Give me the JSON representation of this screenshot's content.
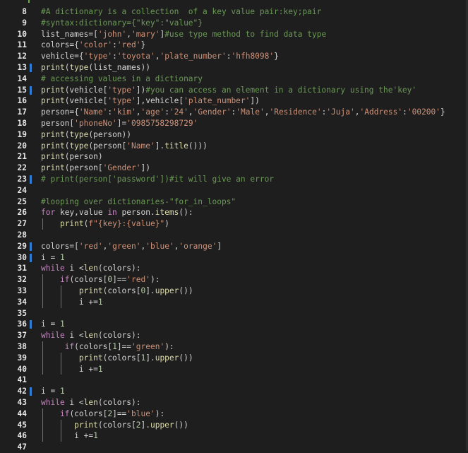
{
  "editor": {
    "lines": [
      {
        "n": "8",
        "bar": false,
        "indent": 0,
        "tokens": [
          [
            "#A dictionary is a collection  of a key value pair:key;pair",
            "t-comment"
          ]
        ]
      },
      {
        "n": "9",
        "bar": false,
        "indent": 0,
        "tokens": [
          [
            "#syntax:dictionary={\"key\":\"value\"}",
            "t-comment"
          ]
        ]
      },
      {
        "n": "10",
        "bar": false,
        "indent": 0,
        "tokens": [
          [
            "list_names",
            "t-plain"
          ],
          [
            "=[",
            "t-plain"
          ],
          [
            "'john'",
            "t-string"
          ],
          [
            ",",
            "t-plain"
          ],
          [
            "'mary'",
            "t-string"
          ],
          [
            "]",
            "t-plain"
          ],
          [
            "#use type method to find data type",
            "t-comment"
          ]
        ]
      },
      {
        "n": "11",
        "bar": false,
        "indent": 0,
        "tokens": [
          [
            "colors",
            "t-plain"
          ],
          [
            "={",
            "t-plain"
          ],
          [
            "'color'",
            "t-string"
          ],
          [
            ":",
            "t-plain"
          ],
          [
            "'red'",
            "t-string"
          ],
          [
            "}",
            "t-plain"
          ]
        ]
      },
      {
        "n": "12",
        "bar": false,
        "indent": 0,
        "tokens": [
          [
            "vehicle",
            "t-plain"
          ],
          [
            "={",
            "t-plain"
          ],
          [
            "'type'",
            "t-string"
          ],
          [
            ":",
            "t-plain"
          ],
          [
            "'toyota'",
            "t-string"
          ],
          [
            ",",
            "t-plain"
          ],
          [
            "'plate_number'",
            "t-string"
          ],
          [
            ":",
            "t-plain"
          ],
          [
            "'hfh8098'",
            "t-string"
          ],
          [
            "}",
            "t-plain"
          ]
        ]
      },
      {
        "n": "13",
        "bar": true,
        "indent": 0,
        "tokens": [
          [
            "print",
            "t-func"
          ],
          [
            "(",
            "t-plain"
          ],
          [
            "type",
            "t-func"
          ],
          [
            "(list_names))",
            "t-plain"
          ]
        ]
      },
      {
        "n": "14",
        "bar": false,
        "indent": 0,
        "tokens": [
          [
            "# accessing values in a dictionary",
            "t-comment"
          ]
        ]
      },
      {
        "n": "15",
        "bar": true,
        "indent": 0,
        "tokens": [
          [
            "print",
            "t-func"
          ],
          [
            "(vehicle[",
            "t-plain"
          ],
          [
            "'type'",
            "t-string"
          ],
          [
            "])",
            "t-plain"
          ],
          [
            "#you can access an element in a dictionary using the'key'",
            "t-comment"
          ]
        ]
      },
      {
        "n": "16",
        "bar": false,
        "indent": 0,
        "tokens": [
          [
            "print",
            "t-func"
          ],
          [
            "(vehicle[",
            "t-plain"
          ],
          [
            "'type'",
            "t-string"
          ],
          [
            "],vehicle[",
            "t-plain"
          ],
          [
            "'plate_number'",
            "t-string"
          ],
          [
            "])",
            "t-plain"
          ]
        ]
      },
      {
        "n": "17",
        "bar": false,
        "indent": 0,
        "tokens": [
          [
            "person",
            "t-plain"
          ],
          [
            "={",
            "t-plain"
          ],
          [
            "'Name'",
            "t-string"
          ],
          [
            ":",
            "t-plain"
          ],
          [
            "'kim'",
            "t-string"
          ],
          [
            ",",
            "t-plain"
          ],
          [
            "'age'",
            "t-string"
          ],
          [
            ":",
            "t-plain"
          ],
          [
            "'24'",
            "t-string"
          ],
          [
            ",",
            "t-plain"
          ],
          [
            "'Gender'",
            "t-string"
          ],
          [
            ":",
            "t-plain"
          ],
          [
            "'Male'",
            "t-string"
          ],
          [
            ",",
            "t-plain"
          ],
          [
            "'Residence'",
            "t-string"
          ],
          [
            ":",
            "t-plain"
          ],
          [
            "'Juja'",
            "t-string"
          ],
          [
            ",",
            "t-plain"
          ],
          [
            "'Address'",
            "t-string"
          ],
          [
            ":",
            "t-plain"
          ],
          [
            "'00200'",
            "t-string"
          ],
          [
            "}",
            "t-plain"
          ]
        ]
      },
      {
        "n": "18",
        "bar": false,
        "indent": 0,
        "tokens": [
          [
            "person[",
            "t-plain"
          ],
          [
            "'phoneNo'",
            "t-string"
          ],
          [
            "]=",
            "t-plain"
          ],
          [
            "'0985758298729'",
            "t-string"
          ]
        ]
      },
      {
        "n": "19",
        "bar": false,
        "indent": 0,
        "tokens": [
          [
            "print",
            "t-func"
          ],
          [
            "(",
            "t-plain"
          ],
          [
            "type",
            "t-func"
          ],
          [
            "(person))",
            "t-plain"
          ]
        ]
      },
      {
        "n": "20",
        "bar": false,
        "indent": 0,
        "tokens": [
          [
            "print",
            "t-func"
          ],
          [
            "(",
            "t-plain"
          ],
          [
            "type",
            "t-func"
          ],
          [
            "(person[",
            "t-plain"
          ],
          [
            "'Name'",
            "t-string"
          ],
          [
            "].",
            "t-plain"
          ],
          [
            "title",
            "t-func"
          ],
          [
            "()))",
            "t-plain"
          ]
        ]
      },
      {
        "n": "21",
        "bar": false,
        "indent": 0,
        "tokens": [
          [
            "print",
            "t-func"
          ],
          [
            "(person)",
            "t-plain"
          ]
        ]
      },
      {
        "n": "22",
        "bar": false,
        "indent": 0,
        "tokens": [
          [
            "print",
            "t-func"
          ],
          [
            "(person[",
            "t-plain"
          ],
          [
            "'Gender'",
            "t-string"
          ],
          [
            "])",
            "t-plain"
          ]
        ]
      },
      {
        "n": "23",
        "bar": true,
        "indent": 0,
        "tokens": [
          [
            "# print(person['password'])#it will give an error",
            "t-comment"
          ]
        ]
      },
      {
        "n": "24",
        "bar": false,
        "indent": 0,
        "tokens": []
      },
      {
        "n": "25",
        "bar": false,
        "indent": 0,
        "tokens": [
          [
            "#looping over dictionaries-\"for_in_loops\"",
            "t-comment"
          ]
        ]
      },
      {
        "n": "26",
        "bar": false,
        "indent": 0,
        "tokens": [
          [
            "for",
            "t-kw"
          ],
          [
            " key,value ",
            "t-plain"
          ],
          [
            "in",
            "t-kw"
          ],
          [
            " person.",
            "t-plain"
          ],
          [
            "items",
            "t-func"
          ],
          [
            "():",
            "t-plain"
          ]
        ]
      },
      {
        "n": "27",
        "bar": false,
        "indent": 1,
        "tokens": [
          [
            "    ",
            "t-plain"
          ],
          [
            "print",
            "t-func"
          ],
          [
            "(",
            "t-plain"
          ],
          [
            "f\"{key}:{value}\"",
            "t-string"
          ],
          [
            ")",
            "t-plain"
          ]
        ]
      },
      {
        "n": "28",
        "bar": false,
        "indent": 0,
        "tokens": []
      },
      {
        "n": "29",
        "bar": true,
        "indent": 0,
        "tokens": [
          [
            "colors",
            "t-plain"
          ],
          [
            "=[",
            "t-plain"
          ],
          [
            "'red'",
            "t-string"
          ],
          [
            ",",
            "t-plain"
          ],
          [
            "'green'",
            "t-string"
          ],
          [
            ",",
            "t-plain"
          ],
          [
            "'blue'",
            "t-string"
          ],
          [
            ",",
            "t-plain"
          ],
          [
            "'orange'",
            "t-string"
          ],
          [
            "]",
            "t-plain"
          ]
        ]
      },
      {
        "n": "30",
        "bar": true,
        "indent": 0,
        "tokens": [
          [
            "i = ",
            "t-plain"
          ],
          [
            "1",
            "t-num"
          ]
        ]
      },
      {
        "n": "31",
        "bar": false,
        "indent": 0,
        "tokens": [
          [
            "while",
            "t-kw"
          ],
          [
            " i <",
            "t-plain"
          ],
          [
            "len",
            "t-func"
          ],
          [
            "(colors):",
            "t-plain"
          ]
        ]
      },
      {
        "n": "32",
        "bar": false,
        "indent": 1,
        "tokens": [
          [
            "    ",
            "t-plain"
          ],
          [
            "if",
            "t-kw"
          ],
          [
            "(colors[",
            "t-plain"
          ],
          [
            "0",
            "t-num"
          ],
          [
            "]==",
            "t-plain"
          ],
          [
            "'red'",
            "t-string"
          ],
          [
            "):",
            "t-plain"
          ]
        ]
      },
      {
        "n": "33",
        "bar": false,
        "indent": 2,
        "tokens": [
          [
            "        ",
            "t-plain"
          ],
          [
            "print",
            "t-func"
          ],
          [
            "(colors[",
            "t-plain"
          ],
          [
            "0",
            "t-num"
          ],
          [
            "].",
            "t-plain"
          ],
          [
            "upper",
            "t-func"
          ],
          [
            "())",
            "t-plain"
          ]
        ]
      },
      {
        "n": "34",
        "bar": false,
        "indent": 2,
        "tokens": [
          [
            "        i +=",
            "t-plain"
          ],
          [
            "1",
            "t-num"
          ]
        ]
      },
      {
        "n": "35",
        "bar": false,
        "indent": 0,
        "tokens": []
      },
      {
        "n": "36",
        "bar": true,
        "indent": 0,
        "tokens": [
          [
            "i = ",
            "t-plain"
          ],
          [
            "1",
            "t-num"
          ]
        ]
      },
      {
        "n": "37",
        "bar": false,
        "indent": 0,
        "tokens": [
          [
            "while",
            "t-kw"
          ],
          [
            " i <",
            "t-plain"
          ],
          [
            "len",
            "t-func"
          ],
          [
            "(colors):",
            "t-plain"
          ]
        ]
      },
      {
        "n": "38",
        "bar": false,
        "indent": 1,
        "tokens": [
          [
            "     ",
            "t-plain"
          ],
          [
            "if",
            "t-kw"
          ],
          [
            "(colors[",
            "t-plain"
          ],
          [
            "1",
            "t-num"
          ],
          [
            "]==",
            "t-plain"
          ],
          [
            "'green'",
            "t-string"
          ],
          [
            "):",
            "t-plain"
          ]
        ]
      },
      {
        "n": "39",
        "bar": false,
        "indent": 2,
        "tokens": [
          [
            "        ",
            "t-plain"
          ],
          [
            "print",
            "t-func"
          ],
          [
            "(colors[",
            "t-plain"
          ],
          [
            "1",
            "t-num"
          ],
          [
            "].",
            "t-plain"
          ],
          [
            "upper",
            "t-func"
          ],
          [
            "())",
            "t-plain"
          ]
        ]
      },
      {
        "n": "40",
        "bar": false,
        "indent": 2,
        "tokens": [
          [
            "        i +=",
            "t-plain"
          ],
          [
            "1",
            "t-num"
          ]
        ]
      },
      {
        "n": "41",
        "bar": false,
        "indent": 0,
        "tokens": []
      },
      {
        "n": "42",
        "bar": true,
        "indent": 0,
        "tokens": [
          [
            "i = ",
            "t-plain"
          ],
          [
            "1",
            "t-num"
          ]
        ]
      },
      {
        "n": "43",
        "bar": false,
        "indent": 0,
        "tokens": [
          [
            "while",
            "t-kw"
          ],
          [
            " i <",
            "t-plain"
          ],
          [
            "len",
            "t-func"
          ],
          [
            "(colors):",
            "t-plain"
          ]
        ]
      },
      {
        "n": "44",
        "bar": false,
        "indent": 1,
        "tokens": [
          [
            "    ",
            "t-plain"
          ],
          [
            "if",
            "t-kw"
          ],
          [
            "(colors[",
            "t-plain"
          ],
          [
            "2",
            "t-num"
          ],
          [
            "]==",
            "t-plain"
          ],
          [
            "'blue'",
            "t-string"
          ],
          [
            "):",
            "t-plain"
          ]
        ]
      },
      {
        "n": "45",
        "bar": false,
        "indent": 2,
        "tokens": [
          [
            "       ",
            "t-plain"
          ],
          [
            "print",
            "t-func"
          ],
          [
            "(colors[",
            "t-plain"
          ],
          [
            "2",
            "t-num"
          ],
          [
            "].",
            "t-plain"
          ],
          [
            "upper",
            "t-func"
          ],
          [
            "())",
            "t-plain"
          ]
        ]
      },
      {
        "n": "46",
        "bar": false,
        "indent": 2,
        "tokens": [
          [
            "       i +=",
            "t-plain"
          ],
          [
            "1",
            "t-num"
          ]
        ]
      },
      {
        "n": "47",
        "bar": false,
        "indent": 0,
        "tokens": []
      }
    ]
  }
}
